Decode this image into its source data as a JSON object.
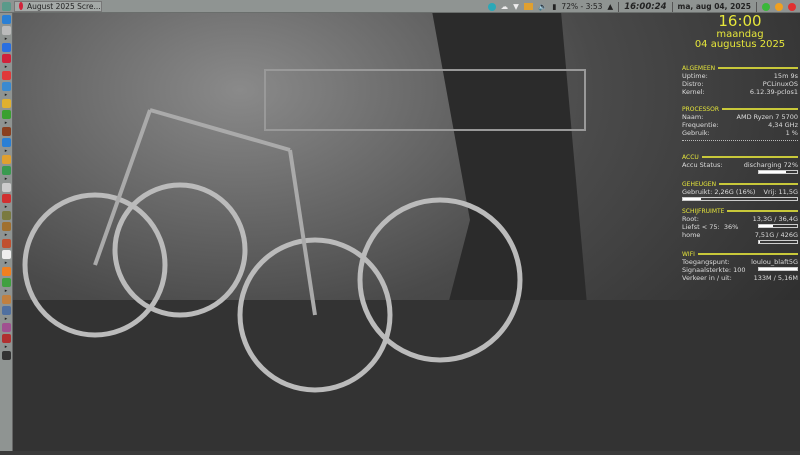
{
  "taskbar": {
    "window_title": "August 2025 Scre...",
    "battery": "72% - 3:53",
    "time": "16:00:24",
    "date": "ma, aug 04, 2025"
  },
  "side_icons": [
    {
      "name": "desktop-icon",
      "color": "#2a7fd4"
    },
    {
      "name": "menu-icon",
      "color": "#bbb"
    },
    {
      "name": "browser-icon",
      "color": "#2a6fe0"
    },
    {
      "name": "opera-icon",
      "color": "#d0223a"
    },
    {
      "name": "app-icon",
      "color": "#e03a3a"
    },
    {
      "name": "network-icon",
      "color": "#3a8ad0"
    },
    {
      "name": "folder-icon",
      "color": "#e0b030"
    },
    {
      "name": "tree-icon",
      "color": "#3aa030"
    },
    {
      "name": "media-icon",
      "color": "#8a4020"
    },
    {
      "name": "docs-icon",
      "color": "#2a7fd4"
    },
    {
      "name": "files-icon",
      "color": "#e0a030"
    },
    {
      "name": "calc-icon",
      "color": "#3a9a50"
    },
    {
      "name": "image-icon",
      "color": "#ccc"
    },
    {
      "name": "pdf-icon",
      "color": "#d03030"
    },
    {
      "name": "paint-icon",
      "color": "#7a7a40"
    },
    {
      "name": "gimp-icon",
      "color": "#a07030"
    },
    {
      "name": "calendar-icon",
      "color": "#c05030"
    },
    {
      "name": "wing-icon",
      "color": "#eee"
    },
    {
      "name": "vlc-icon",
      "color": "#f08020"
    },
    {
      "name": "audio-icon",
      "color": "#40a040"
    },
    {
      "name": "weather-icon",
      "color": "#c08040"
    },
    {
      "name": "settings-icon",
      "color": "#5070a0"
    },
    {
      "name": "photo-icon",
      "color": "#a05090"
    },
    {
      "name": "tool-icon",
      "color": "#b03030"
    },
    {
      "name": "terminal-icon",
      "color": "#333"
    }
  ],
  "conky": {
    "time": "16:00",
    "day": "maandag",
    "date": "04 augustus 2025",
    "algemeen": {
      "title": "ALGEMEEN",
      "rows": [
        [
          "Uptime:",
          "15m 9s"
        ],
        [
          "Distro:",
          "PCLinuxOS"
        ],
        [
          "Kernel:",
          "6.12.39-pclos1"
        ]
      ]
    },
    "processor": {
      "title": "PROCESSOR",
      "rows": [
        [
          "Naam:",
          "AMD Ryzen 7 5700"
        ],
        [
          "Frequentie:",
          "4,34 GHz"
        ],
        [
          "Gebruik:",
          "1 %"
        ]
      ]
    },
    "accu": {
      "title": "ACCU",
      "label": "Accu Status:",
      "value": "discharging 72%",
      "percent": 72
    },
    "geheugen": {
      "title": "GEHEUGEN",
      "used": "Gebruikt: 2,26G (16%)",
      "free": "Vrij: 11,5G",
      "percent": 16
    },
    "schijf": {
      "title": "SCHIJFRUIMTE",
      "root_label": "Root:",
      "root_value": "13,3G / 36,4G",
      "root_percent": 36,
      "fav": "Liefst < 75:",
      "fav_value": "36%",
      "home_label": "home",
      "home_value": "7,51G / 426G",
      "home_percent": 2
    },
    "wifi": {
      "title": "WIFI",
      "ap_label": "Toegangspunt:",
      "ap": "loulou_blaft5G",
      "sig_label": "Signaalsterkte:",
      "sig": "100",
      "traffic_label": "Verkeer in / uit:",
      "traffic": "133M   / 5,16M"
    }
  }
}
